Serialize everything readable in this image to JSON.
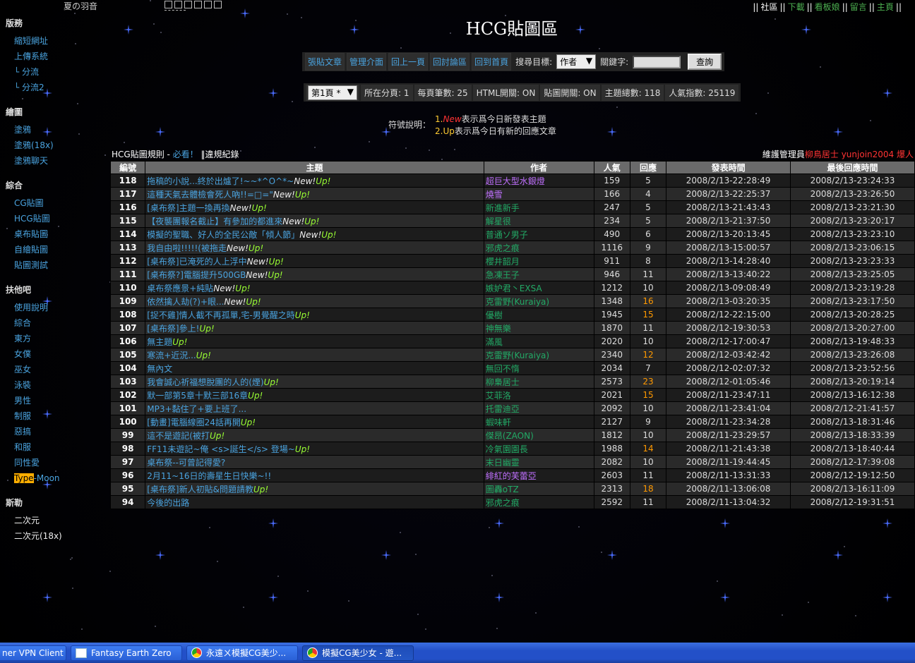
{
  "header": {
    "top_left_title": "夏の羽音",
    "page_title": "HCG貼圖區",
    "top_links": [
      "社區",
      "下載",
      "看板娘",
      "留言",
      "主頁"
    ]
  },
  "sidebar": {
    "sections": [
      {
        "head": "版務",
        "items": [
          "縮短網址",
          "上傳系統",
          "└ 分流",
          "└ 分流2"
        ]
      },
      {
        "head": "繪圖",
        "items": [
          "塗鴉",
          "塗鴉(18x)",
          "塗鴉聊天"
        ]
      },
      {
        "head": "綜合",
        "items": [
          "CG貼圖",
          "HCG貼圖",
          "桌布貼圖",
          "自繪貼圖",
          "貼圖測試"
        ]
      },
      {
        "head": "扶他吧",
        "items": [
          "使用說明",
          "綜合",
          "東方",
          "女僕",
          "巫女",
          "泳裝",
          "男性",
          "制服",
          "惡搞",
          "和服",
          "同性愛",
          "Type-Moon"
        ]
      },
      {
        "head": "斯勒",
        "items": [
          "二次元",
          "二次元(18x)"
        ]
      }
    ]
  },
  "actions": {
    "buttons": [
      "張貼文章",
      "管理介面",
      "回上一頁",
      "回討論區",
      "回到首頁"
    ],
    "search_label": "搜尋目標:",
    "search_target": "作者",
    "keyword_label": "關鍵字:",
    "query_button": "查詢"
  },
  "info": {
    "page_select": "第1頁 *",
    "current_page": "所在分頁: 1",
    "per_page": "每頁筆數: 25",
    "html_switch": "HTML開關: ON",
    "image_switch": "貼圖開關: ON",
    "total_topics": "主題總數: 118",
    "popularity": "人氣指數: 25119"
  },
  "legend": {
    "label": "符號說明：",
    "line1_prefix": "1.",
    "line1_new": "New",
    "line1_text": "表示爲今日新發表主題",
    "line2_prefix": "2.",
    "line2_up": "Up",
    "line2_text": "表示爲今日有新的回應文章"
  },
  "rules": {
    "prefix": "HCG貼圖規則 - ",
    "must_read": "必看！",
    "sep": " ‖",
    "violation": "違規紀錄"
  },
  "admin": {
    "label": "維護管理員",
    "names": "柳鳥居士 yunjoin2004 爆人"
  },
  "table": {
    "headers": [
      "編號",
      "主題",
      "作者",
      "人氣",
      "回應",
      "發表時間",
      "最後回應時間"
    ],
    "rows": [
      {
        "no": "118",
        "title": "拖稿的小說...終於出爐了!~~*^O^*~",
        "new": "New!",
        "up": "Up!",
        "author": "超巨大型水銀燈",
        "author_color": "#c070ff",
        "views": "159",
        "replies": "5",
        "hot": false,
        "posted": "2008/2/13-22:28:49",
        "last": "2008/2/13-23:24:33"
      },
      {
        "no": "117",
        "title": "這種天氣去體檢會死人吶!!=□=\"",
        "new": "New!",
        "up": "Up!",
        "author": "燒雪",
        "author_color": "#c070ff",
        "views": "166",
        "replies": "4",
        "hot": false,
        "posted": "2008/2/13-22:25:37",
        "last": "2008/2/13-23:26:50"
      },
      {
        "no": "116",
        "title": "[桌布祭]主題一換再換",
        "new": "New!",
        "up": "Up!",
        "author": "新進新手",
        "author_color": "#22aa66",
        "views": "247",
        "replies": "5",
        "hot": false,
        "posted": "2008/2/13-21:43:43",
        "last": "2008/2/13-23:21:30"
      },
      {
        "no": "115",
        "title": "【夜襲團報名截止】有參加的都進來",
        "new": "New!",
        "up": "Up!",
        "author": "解星很",
        "author_color": "#22aa66",
        "views": "234",
        "replies": "5",
        "hot": false,
        "posted": "2008/2/13-21:37:50",
        "last": "2008/2/13-23:20:17"
      },
      {
        "no": "114",
        "title": "模擬的聖職、好人的全民公敵「傾人節」",
        "new": "New!",
        "up": "Up!",
        "author": "普通ソ男子",
        "author_color": "#22aa66",
        "views": "490",
        "replies": "6",
        "hot": false,
        "posted": "2008/2/13-20:13:45",
        "last": "2008/2/13-23:23:10"
      },
      {
        "no": "113",
        "title": "我自由啦!!!!!(被拖走",
        "new": "New!",
        "up": "Up!",
        "author": "邪虎之痕",
        "author_color": "#22aa66",
        "views": "1116",
        "replies": "9",
        "hot": false,
        "posted": "2008/2/13-15:00:57",
        "last": "2008/2/13-23:06:15"
      },
      {
        "no": "112",
        "title": "[桌布祭]已淹死的人上浮中",
        "new": "New!",
        "up": "Up!",
        "author": "櫻井韶月",
        "author_color": "#22aa66",
        "views": "911",
        "replies": "8",
        "hot": false,
        "posted": "2008/2/13-14:28:40",
        "last": "2008/2/13-23:23:33"
      },
      {
        "no": "111",
        "title": "[桌布祭?]電腦提升500GB",
        "new": "New!",
        "up": "Up!",
        "author": "急凍王子",
        "author_color": "#22aa66",
        "views": "946",
        "replies": "11",
        "hot": false,
        "posted": "2008/2/13-13:40:22",
        "last": "2008/2/13-23:25:05"
      },
      {
        "no": "110",
        "title": "桌布祭應景+純貼",
        "new": "New!",
        "up": "Up!",
        "author": "嫉妒君丶EXSA",
        "author_color": "#22aa66",
        "views": "1212",
        "replies": "10",
        "hot": false,
        "posted": "2008/2/13-09:08:49",
        "last": "2008/2/13-23:19:28"
      },
      {
        "no": "109",
        "title": "依然擒人劫(?)+眼...",
        "new": "New!",
        "up": "Up!",
        "author": "克雷野(Kuraiya)",
        "author_color": "#22aa66",
        "views": "1348",
        "replies": "16",
        "hot": true,
        "posted": "2008/2/13-03:20:35",
        "last": "2008/2/13-23:17:50"
      },
      {
        "no": "108",
        "title": "[捉不雞]情人截不再孤單,宅-男覺醒之時",
        "new": "",
        "up": "Up!",
        "author": "優樹",
        "author_color": "#22aa66",
        "views": "1945",
        "replies": "15",
        "hot": true,
        "posted": "2008/2/12-22:15:00",
        "last": "2008/2/13-20:28:25"
      },
      {
        "no": "107",
        "title": "[桌布祭]參上!",
        "new": "",
        "up": "Up!",
        "author": "神無樂",
        "author_color": "#22aa66",
        "views": "1870",
        "replies": "11",
        "hot": false,
        "posted": "2008/2/12-19:30:53",
        "last": "2008/2/13-20:27:00"
      },
      {
        "no": "106",
        "title": "無主題",
        "new": "",
        "up": "Up!",
        "author": "滿風",
        "author_color": "#22aa66",
        "views": "2020",
        "replies": "10",
        "hot": false,
        "posted": "2008/2/12-17:00:47",
        "last": "2008/2/13-19:48:33"
      },
      {
        "no": "105",
        "title": "寒流+近況...",
        "new": "",
        "up": "Up!",
        "author": "克雷野(Kuraiya)",
        "author_color": "#22aa66",
        "views": "2340",
        "replies": "12",
        "hot": true,
        "posted": "2008/2/12-03:42:42",
        "last": "2008/2/13-23:26:08"
      },
      {
        "no": "104",
        "title": "無內文",
        "new": "",
        "up": "",
        "author": "無回不惰",
        "author_color": "#22aa66",
        "views": "2034",
        "replies": "7",
        "hot": false,
        "posted": "2008/2/12-02:07:32",
        "last": "2008/2/13-23:52:56"
      },
      {
        "no": "103",
        "title": "我會誠心祈福想脫團的人的(煙)",
        "new": "",
        "up": "Up!",
        "author": "柳梟居士",
        "author_color": "#22aa66",
        "views": "2573",
        "replies": "23",
        "hot": true,
        "posted": "2008/2/12-01:05:46",
        "last": "2008/2/13-20:19:14"
      },
      {
        "no": "102",
        "title": "默一部第5章十默三部16章",
        "new": "",
        "up": "Up!",
        "author": "艾菲洛",
        "author_color": "#22aa66",
        "views": "2021",
        "replies": "15",
        "hot": true,
        "posted": "2008/2/11-23:47:11",
        "last": "2008/2/13-16:12:38"
      },
      {
        "no": "101",
        "title": "MP3+黏住了+要上班了...",
        "new": "",
        "up": "",
        "author": "托雷迪亞",
        "author_color": "#22aa66",
        "views": "2092",
        "replies": "10",
        "hot": false,
        "posted": "2008/2/11-23:41:04",
        "last": "2008/2/12-21:41:57"
      },
      {
        "no": "100",
        "title": "[動畫]電腦線圈24話再開",
        "new": "",
        "up": "Up!",
        "author": "蝦味軒",
        "author_color": "#22aa66",
        "views": "2127",
        "replies": "9",
        "hot": false,
        "posted": "2008/2/11-23:34:28",
        "last": "2008/2/13-18:31:46"
      },
      {
        "no": "99",
        "title": "這不是遊記(被打",
        "new": "",
        "up": "Up!",
        "author": "傑昂(ZAON)",
        "author_color": "#22aa66",
        "views": "1812",
        "replies": "10",
        "hot": false,
        "posted": "2008/2/11-23:29:57",
        "last": "2008/2/13-18:33:39"
      },
      {
        "no": "98",
        "title": "FF11未遊記~俺 <s>誕生</s> 登場~",
        "new": "",
        "up": "Up!",
        "author": "冷氣園園長",
        "author_color": "#22aa66",
        "views": "1988",
        "replies": "14",
        "hot": true,
        "posted": "2008/2/11-21:43:38",
        "last": "2008/2/13-18:40:44"
      },
      {
        "no": "97",
        "title": "桌布祭--可曾記得愛?",
        "new": "",
        "up": "",
        "author": "末日幽靈",
        "author_color": "#22aa66",
        "views": "2082",
        "replies": "10",
        "hot": false,
        "posted": "2008/2/11-19:44:45",
        "last": "2008/2/12-17:39:08"
      },
      {
        "no": "96",
        "title": "2月11~16日的壽星生日快樂~!!",
        "new": "",
        "up": "",
        "author": "緋紅的芙蕾亞",
        "author_color": "#c070ff",
        "views": "2603",
        "replies": "11",
        "hot": false,
        "posted": "2008/2/11-13:31:33",
        "last": "2008/2/12-19:12:50"
      },
      {
        "no": "95",
        "title": "[桌布祭]新人初貼&問題請教",
        "new": "",
        "up": "Up!",
        "author": "圖轟oTZ",
        "author_color": "#22aa66",
        "views": "2313",
        "replies": "18",
        "hot": true,
        "posted": "2008/2/11-13:06:08",
        "last": "2008/2/13-16:11:09"
      },
      {
        "no": "94",
        "title": "今後的出路",
        "new": "",
        "up": "",
        "author": "邪虎之痕",
        "author_color": "#22aa66",
        "views": "2592",
        "replies": "11",
        "hot": false,
        "posted": "2008/2/11-13:04:32",
        "last": "2008/2/12-19:31:51"
      }
    ]
  },
  "taskbar": {
    "items": [
      {
        "label": "ner VPN Client ...",
        "icon": "vpn-icon",
        "active": false
      },
      {
        "label": "Fantasy Earth Zero",
        "icon": "window-icon",
        "active": false
      },
      {
        "label": "永遠ㄨ模擬CG美少...",
        "icon": "chrome-icon",
        "active": false
      },
      {
        "label": "模擬CG美少女 - 遊...",
        "icon": "chrome-icon",
        "active": true
      }
    ]
  },
  "colors": {
    "link_blue": "#4aa3df",
    "up_green": "#99ff33",
    "hot_orange": "#ff9900",
    "new_red": "#ff3333"
  }
}
